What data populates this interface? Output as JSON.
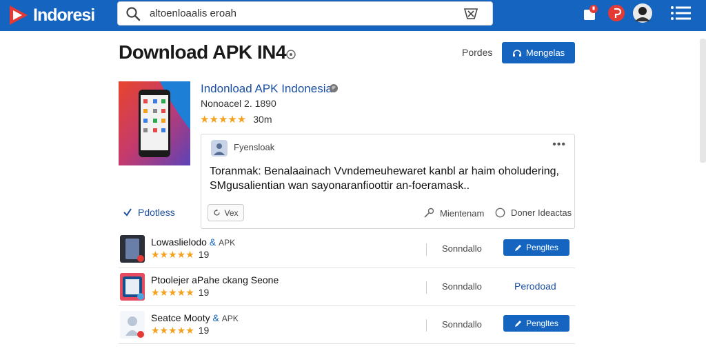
{
  "topbar": {
    "logo_text": "Indoresi",
    "search_value": "altoenloaalis eroah",
    "colors": {
      "bar": "#1565c0",
      "accent_red": "#e53935"
    }
  },
  "header": {
    "title": "Download APK IN4",
    "link": "Pordes",
    "button": "Mengelas"
  },
  "app": {
    "name": "Indonload APK Indonesia",
    "meta": "Nonoacel 2. 1890",
    "stars": "★★★★★",
    "count": "30m",
    "side_link": "Pdotless"
  },
  "card": {
    "author": "Fyensloak",
    "menu": "•••",
    "text": "Toranmak: Benalaainach Vvndemeuhewaret kanbl ar haim oholudering, SMgusalientian wan sayonaranfioottir an-foeramask..",
    "chip": "Vex",
    "action1": "Mientenam",
    "action2": "Doner Ideactas"
  },
  "list": [
    {
      "name": "Lowaslielodo",
      "tag": "&",
      "tag2": "APK",
      "stars": "★★★★★",
      "rating": "19",
      "size": "Sonndallo",
      "action": "Pengltes",
      "action_type": "button"
    },
    {
      "name": "Ptoolejer aPahe ckang Seone",
      "tag": "",
      "tag2": "",
      "stars": "★★★★★",
      "rating": "19",
      "size": "Sonndallo",
      "action": "Perodoad",
      "action_type": "link"
    },
    {
      "name": "Seatce Mooty",
      "tag": "&",
      "tag2": "APK",
      "stars": "★★★★★",
      "rating": "19",
      "size": "Sonndallo",
      "action": "Pengltes",
      "action_type": "button"
    }
  ]
}
